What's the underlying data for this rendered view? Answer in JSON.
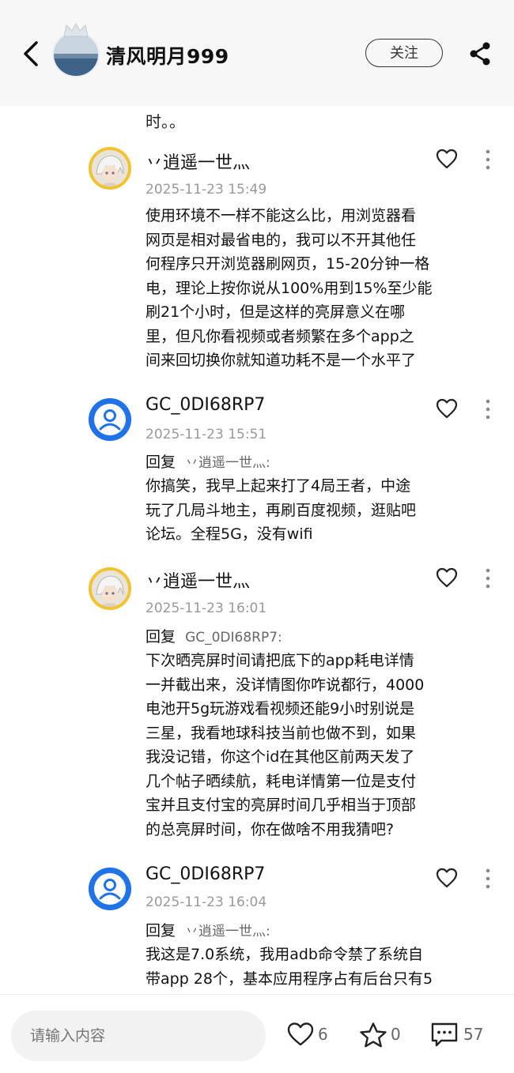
{
  "header": {
    "username": "清风明月999",
    "follow_label": "关注",
    "icons": [
      "back-arrow-icon",
      "crown-icon",
      "share-icon"
    ]
  },
  "cut_text": "时。。",
  "comments": [
    {
      "author": "丷逍遥一世灬",
      "avatar": "anime-avatar",
      "time": "2025-11-23 15:49",
      "reply_label": "",
      "reply_to": "",
      "lines": [
        "使用环境不一样不能这么比，用浏览器看",
        "网页是相对最省电的，我可以不开其他任",
        "何程序只开浏览器刷网页，15-20分钟一格",
        "电，理论上按你说从100%用到15%至少能",
        "刷21个小时，但是这样的亮屏意义在哪",
        "里，但凡你看视频或者频繁在多个app之",
        "间来回切换你就知道功耗不是一个水平了"
      ]
    },
    {
      "author": "GC_0DI68RP7",
      "avatar": "default-avatar",
      "time": "2025-11-23 15:51",
      "reply_label": "回复",
      "reply_to": "丷逍遥一世灬:",
      "lines": [
        "你搞笑，我早上起来打了4局王者，中途",
        "玩了几局斗地主，再刷百度视频，逛贴吧",
        "论坛。全程5G，没有wifi"
      ]
    },
    {
      "author": "丷逍遥一世灬",
      "avatar": "anime-avatar",
      "time": "2025-11-23 16:01",
      "reply_label": "回复",
      "reply_to": "GC_0DI68RP7:",
      "lines": [
        "下次晒亮屏时间请把底下的app耗电详情",
        "一并截出来，没详情图你咋说都行，4000",
        "电池开5g玩游戏看视频还能9小时别说是",
        "三星，我看地球科技当前也做不到，如果",
        "我没记错，你这个id在其他区前两天发了",
        "几个帖子晒续航，耗电详情第一位是支付",
        "宝并且支付宝的亮屏时间几乎相当于顶部",
        "的总亮屏时间，你在做啥不用我猜吧?"
      ]
    },
    {
      "author": "GC_0DI68RP7",
      "avatar": "default-avatar",
      "time": "2025-11-23 16:04",
      "reply_label": "回复",
      "reply_to": "丷逍遥一世灬:",
      "lines": [
        "我这是7.0系统，我用adb命令禁了系统自",
        "带app 28个，基本应用程序占有后台只有5"
      ]
    }
  ],
  "bottom_bar": {
    "input_placeholder": "请输入内容",
    "like_count": "6",
    "star_count": "0",
    "comment_count": "57",
    "icons": [
      "heart-icon",
      "star-icon",
      "comment-icon"
    ]
  }
}
